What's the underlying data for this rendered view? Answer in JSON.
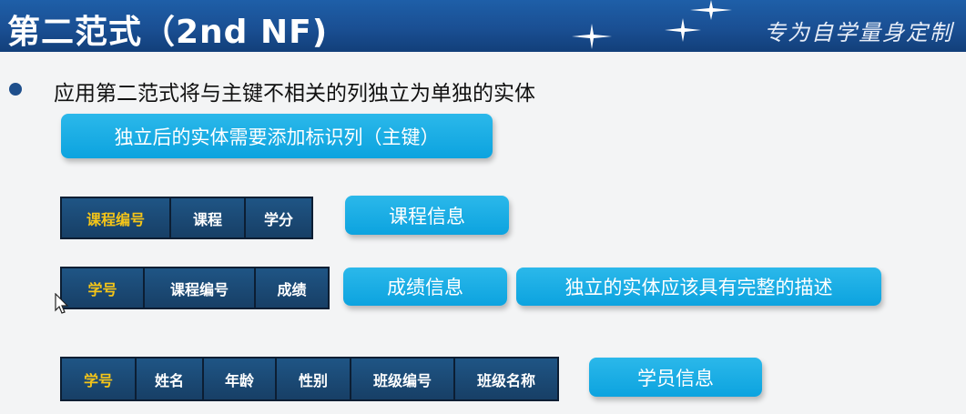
{
  "header": {
    "title": "第二范式（2nd NF)",
    "brand": "专为自学量身定制"
  },
  "bullet": {
    "text": "应用第二范式将与主键不相关的列独立为单独的实体"
  },
  "callout_top": "独立后的实体需要添加标识列（主键）",
  "course_table": {
    "columns": [
      "课程编号",
      "课程",
      "学分"
    ],
    "key_column": "课程编号",
    "label": "课程信息"
  },
  "score_table": {
    "columns": [
      "学号",
      "课程编号",
      "成绩"
    ],
    "key_column": "学号",
    "label": "成绩信息",
    "note": "独立的实体应该具有完整的描述"
  },
  "student_table": {
    "columns": [
      "学号",
      "姓名",
      "年龄",
      "性别",
      "班级编号",
      "班级名称"
    ],
    "key_column": "学号",
    "label": "学员信息"
  },
  "colors": {
    "header_bg": "#1a4f93",
    "pill_bg": "#0ca3df",
    "table_bg": "#1b4a73",
    "key_text": "#f5c518"
  }
}
